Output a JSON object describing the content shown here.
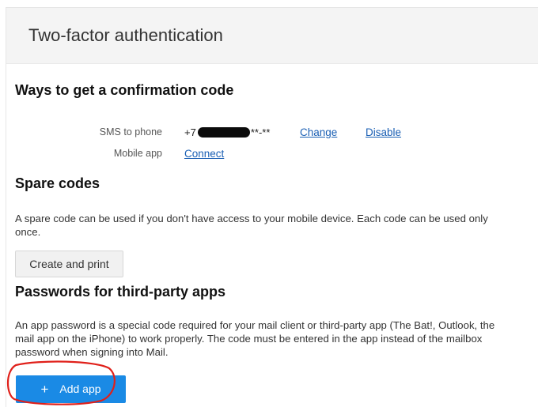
{
  "header": {
    "title": "Two-factor authentication"
  },
  "confirmation": {
    "title": "Ways to get a confirmation code",
    "sms": {
      "label": "SMS to phone",
      "phone_prefix": "+7",
      "phone_suffix": "**-**",
      "change_link": "Change",
      "disable_link": "Disable"
    },
    "mobile": {
      "label": "Mobile app",
      "connect_link": "Connect"
    }
  },
  "spare_codes": {
    "title": "Spare codes",
    "description": "A spare code can be used if you don't have access to your mobile device. Each code can be used only once.",
    "button_label": "Create and print"
  },
  "third_party": {
    "title": "Passwords for third-party apps",
    "description": "An app password is a special code required for your mail client or third-party app (The Bat!, Outlook, the mail app on the iPhone) to work properly. The code must be entered in the app instead of the mailbox password when signing into Mail.",
    "button_icon": "plus-icon",
    "button_label": "Add app"
  },
  "annotation": {
    "color": "#e0201a"
  },
  "colors": {
    "link": "#1a5fb4",
    "primary_button": "#1a8ae5",
    "header_bg": "#f4f4f4"
  }
}
